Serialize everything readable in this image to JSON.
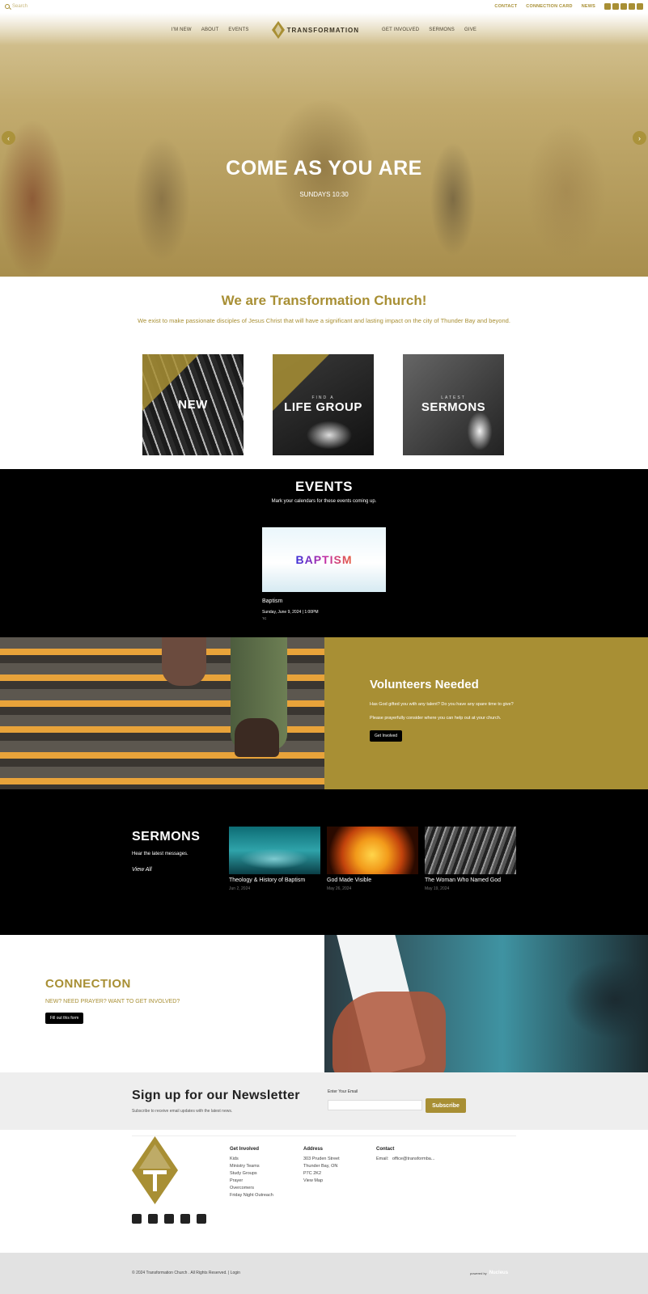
{
  "topbar": {
    "search_placeholder": "Search",
    "links": [
      "CONTACT",
      "CONNECTION CARD",
      "NEWS"
    ],
    "social_icons": [
      "facebook-icon",
      "instagram-icon",
      "youtube-icon",
      "podcast-icon",
      "spotify-icon"
    ]
  },
  "nav": {
    "left": [
      "I'M NEW",
      "ABOUT",
      "EVENTS"
    ],
    "right": [
      "GET INVOLVED",
      "SERMONS",
      "GIVE"
    ],
    "logo_text": "TRANSFORMATION"
  },
  "hero": {
    "title": "COME AS YOU ARE",
    "subtitle": "SUNDAYS 10:30"
  },
  "intro": {
    "title": "We are Transformation Church!",
    "text": "We exist to make passionate disciples of Jesus Christ that will have a significant and lasting impact on the city of Thunder Bay and beyond.",
    "tiles": [
      {
        "small": "",
        "big": "NEW"
      },
      {
        "small": "FIND A",
        "big": "LIFE GROUP"
      },
      {
        "small": "LATEST",
        "big": "SERMONS"
      }
    ]
  },
  "events": {
    "title": "EVENTS",
    "subtitle": "Mark your calendars for these events coming up.",
    "items": [
      {
        "image_text": "BAPTISM",
        "name": "Baptism",
        "date": "Sunday, June 9, 2024 | 1:00PM",
        "tag": "TC"
      }
    ]
  },
  "volunteers": {
    "title": "Volunteers Needed",
    "line1": "Has God gifted you with any talent? Do you have any spare time to give?",
    "line2": "Please prayerfully consider where you can help out at your church.",
    "button": "Get Involved"
  },
  "sermons": {
    "title": "SERMONS",
    "subtitle": "Hear the latest messages.",
    "view_all": "View All",
    "items": [
      {
        "title": "Theology & History of Baptism",
        "date": "Jun 2, 2024"
      },
      {
        "title": "God Made Visible",
        "date": "May 26, 2024"
      },
      {
        "title": "The Woman Who Named God",
        "date": "May 19, 2024"
      }
    ]
  },
  "connection": {
    "title": "CONNECTION",
    "subtitle": "NEW? NEED PRAYER? WANT TO GET INVOLVED?",
    "button": "Fill out this form"
  },
  "newsletter": {
    "title": "Sign up for our Newsletter",
    "subtitle": "Subscribe to receive email updates with the latest news.",
    "email_label": "Enter Your Email",
    "email_value": "",
    "button": "Subscribe"
  },
  "footer": {
    "get_involved": {
      "heading": "Get Involved",
      "links": [
        "Kids",
        "Ministry Teams",
        "Study Groups",
        "Prayer",
        "Overcomers",
        "Friday Night Outreach"
      ]
    },
    "address": {
      "heading": "Address",
      "lines": [
        "303 Pruden Street",
        "Thunder Bay, ON",
        "P7C 2K2"
      ],
      "map_link": "View Map"
    },
    "contact": {
      "heading": "Contact",
      "email_label": "Email:",
      "email": "office@transformba..."
    },
    "social_icons": [
      "facebook-icon",
      "instagram-icon",
      "youtube-icon",
      "podcast-icon",
      "spotify-icon"
    ]
  },
  "bottom": {
    "copyright": "© 2024 Transformation Church . All Rights Reserved. | Login",
    "powered_by": "powered by",
    "brand": "Nucleus"
  },
  "colors": {
    "accent": "#a88f34",
    "dark": "#000000",
    "light_bg": "#eeeeee"
  }
}
